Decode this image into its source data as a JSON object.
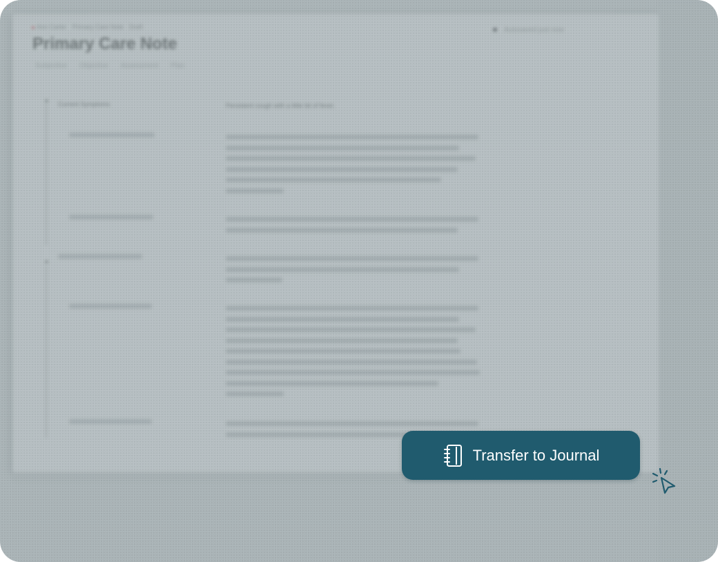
{
  "document": {
    "breadcrumb": [
      "Ann Carter",
      "Primary Care Note",
      "Draft"
    ],
    "title": "Primary Care Note",
    "tabs": [
      "Subjective",
      "Objective",
      "Assessment",
      "Plan"
    ],
    "status": "Autosaved just now",
    "sections": [
      {
        "label": "Current Symptoms",
        "value": "Persistent cough with a little bit of fever."
      }
    ]
  },
  "cta": {
    "label": "Transfer to Journal",
    "icon": "notebook-icon"
  },
  "cursor": {
    "icon": "click-cursor-icon"
  },
  "colors": {
    "accent": "#205b6e",
    "backdrop": "#a9b3b6"
  }
}
